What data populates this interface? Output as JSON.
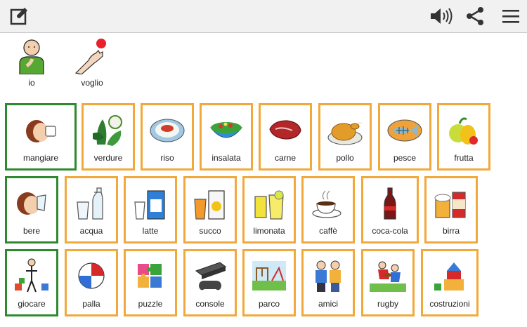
{
  "toolbar": {
    "icons": [
      "edit-icon",
      "speaker-icon",
      "share-icon",
      "menu-icon"
    ]
  },
  "sentence": [
    {
      "label": "io",
      "icon": "person-pointing-self-icon"
    },
    {
      "label": "voglio",
      "icon": "hand-reaching-icon"
    }
  ],
  "rows": [
    [
      {
        "label": "mangiare",
        "icon": "eating-icon",
        "category": "verb"
      },
      {
        "label": "verdure",
        "icon": "vegetables-icon",
        "category": "noun"
      },
      {
        "label": "riso",
        "icon": "rice-icon",
        "category": "noun"
      },
      {
        "label": "insalata",
        "icon": "salad-icon",
        "category": "noun"
      },
      {
        "label": "carne",
        "icon": "meat-icon",
        "category": "noun"
      },
      {
        "label": "pollo",
        "icon": "chicken-icon",
        "category": "noun"
      },
      {
        "label": "pesce",
        "icon": "fish-icon",
        "category": "noun"
      },
      {
        "label": "frutta",
        "icon": "fruit-icon",
        "category": "noun"
      }
    ],
    [
      {
        "label": "bere",
        "icon": "drinking-icon",
        "category": "verb"
      },
      {
        "label": "acqua",
        "icon": "water-icon",
        "category": "noun"
      },
      {
        "label": "latte",
        "icon": "milk-icon",
        "category": "noun"
      },
      {
        "label": "succo",
        "icon": "juice-icon",
        "category": "noun"
      },
      {
        "label": "limonata",
        "icon": "lemonade-icon",
        "category": "noun"
      },
      {
        "label": "caffè",
        "icon": "coffee-icon",
        "category": "noun"
      },
      {
        "label": "coca-cola",
        "icon": "cola-icon",
        "category": "noun"
      },
      {
        "label": "birra",
        "icon": "beer-icon",
        "category": "noun"
      }
    ],
    [
      {
        "label": "giocare",
        "icon": "playing-icon",
        "category": "verb"
      },
      {
        "label": "palla",
        "icon": "ball-icon",
        "category": "noun"
      },
      {
        "label": "puzzle",
        "icon": "puzzle-icon",
        "category": "noun"
      },
      {
        "label": "console",
        "icon": "game-console-icon",
        "category": "noun"
      },
      {
        "label": "parco",
        "icon": "park-icon",
        "category": "noun"
      },
      {
        "label": "amici",
        "icon": "friends-icon",
        "category": "noun"
      },
      {
        "label": "rugby",
        "icon": "rugby-icon",
        "category": "noun"
      },
      {
        "label": "costruzioni",
        "icon": "building-blocks-icon",
        "category": "noun"
      }
    ]
  ],
  "colors": {
    "verb_border": "#2f8a2f",
    "noun_border": "#f2a93b",
    "toolbar_bg": "#f1f1f1"
  }
}
